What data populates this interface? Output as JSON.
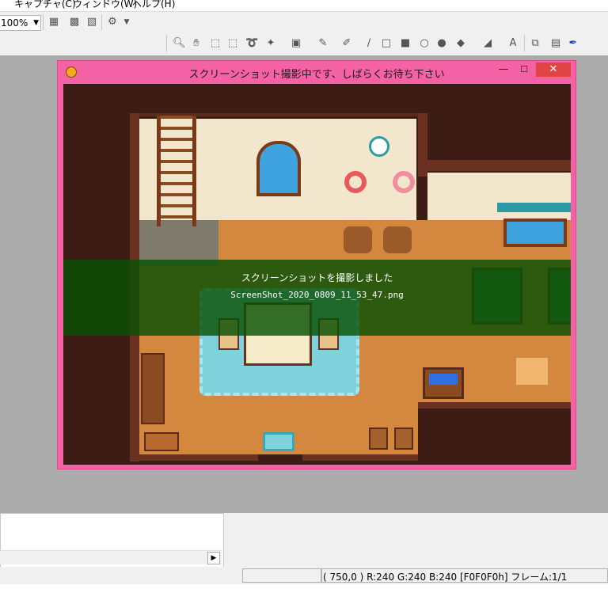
{
  "menu": {
    "capture": "キャプチャ(C)",
    "window": "ウィンドウ(W)",
    "help": "ヘルプ(H)"
  },
  "toolbar": {
    "zoom_value": "100%"
  },
  "captured_window": {
    "title": "スクリーンショット撮影中です、しばらくお待ち下さい"
  },
  "overlay": {
    "message": "スクリーンショットを撮影しました",
    "filename": "ScreenShot_2020_0809_11_53_47.png"
  },
  "status": {
    "text": "( 750,0 ) R:240 G:240 B:240  [F0F0F0h]  フレーム:1/1"
  },
  "colors": {
    "window_frame": "#f461a4",
    "banner": "#0a5005",
    "workarea": "#ababab"
  }
}
